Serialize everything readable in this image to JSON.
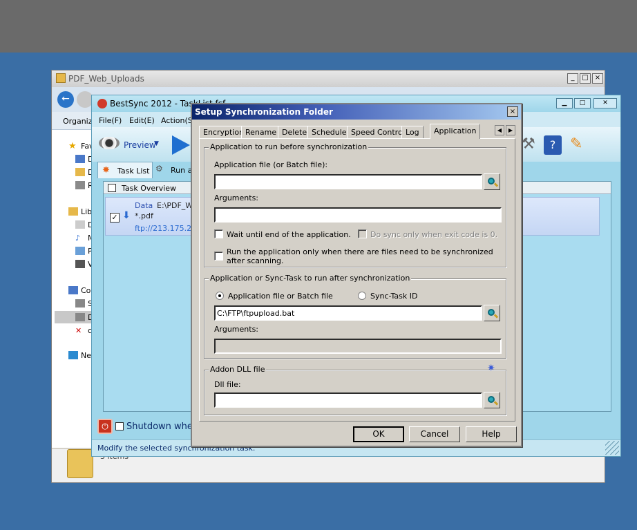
{
  "explorer": {
    "title": "PDF_Web_Uploads",
    "organize": "Organiz",
    "nav_items": [
      "Fav",
      "D",
      "D",
      "R",
      "Libr",
      "D",
      "M",
      "P",
      "V",
      "Co",
      "S",
      "D",
      "c",
      "Ne"
    ],
    "item_count": "3 items"
  },
  "bestsync": {
    "title": "BestSync 2012 - TaskList.fsf",
    "menu": [
      "File(F)",
      "Edit(E)",
      "Action(S)"
    ],
    "preview_label": "Preview",
    "tab_task_list": "Task List",
    "tab_run_as": "Run as",
    "list_header": "Task Overview",
    "row": {
      "label": "Data",
      "path": "E:\\PDF_W",
      "filter": "*.pdf",
      "remote": "ftp://213.175.219"
    },
    "shutdown_label": "Shutdown when",
    "status": "Modify the selected synchronization task."
  },
  "dialog": {
    "title": "Setup Synchronization Folder",
    "close": "×",
    "tabs": [
      "Encryption",
      "Rename",
      "Delete",
      "Schedule",
      "Speed Control",
      "Log",
      "Application"
    ],
    "active_tab": "Application",
    "before": {
      "group_title": "Application to run before synchronization",
      "app_label": "Application file (or Batch file):",
      "app_value": "",
      "args_label": "Arguments:",
      "args_value": "",
      "wait_label": "Wait until end of the application.",
      "exit_code_label": "Do sync only when exit code is 0.",
      "run_only_label": "Run the application only when there are files need to be synchronized after scanning."
    },
    "after": {
      "group_title": "Application or Sync-Task to run after synchronization",
      "radio_app": "Application file or Batch file",
      "radio_task": "Sync-Task ID",
      "app_value": "C:\\FTP\\ftpupload.bat",
      "args_label": "Arguments:",
      "args_value": ""
    },
    "addon": {
      "group_title": "Addon DLL file",
      "dll_label": "Dll file:",
      "dll_value": ""
    },
    "buttons": {
      "ok": "OK",
      "cancel": "Cancel",
      "help": "Help"
    }
  }
}
